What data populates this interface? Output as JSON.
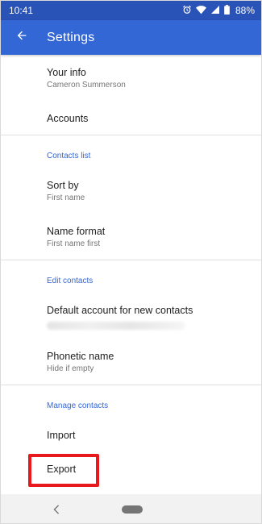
{
  "status_bar": {
    "time": "10:41",
    "battery": "88%",
    "icons": [
      "alarm-icon",
      "wifi-icon",
      "signal-icon",
      "battery-icon"
    ]
  },
  "app_bar": {
    "title": "Settings",
    "back_icon": "arrow-back-icon",
    "color": "#3367d6"
  },
  "settings": {
    "your_info": {
      "title": "Your info",
      "subtitle": "Cameron Summerson"
    },
    "accounts": {
      "title": "Accounts"
    },
    "contacts_list": {
      "header": "Contacts list",
      "sort_by": {
        "title": "Sort by",
        "subtitle": "First name"
      },
      "name_format": {
        "title": "Name format",
        "subtitle": "First name first"
      }
    },
    "edit_contacts": {
      "header": "Edit contacts",
      "default_account": {
        "title": "Default account for new contacts"
      },
      "phonetic_name": {
        "title": "Phonetic name",
        "subtitle": "Hide if empty"
      }
    },
    "manage_contacts": {
      "header": "Manage contacts",
      "import": {
        "title": "Import"
      },
      "export": {
        "title": "Export"
      }
    }
  },
  "colors": {
    "accent": "#3367d6",
    "status_bar": "#2a53b8",
    "highlight": "#e8191c"
  }
}
